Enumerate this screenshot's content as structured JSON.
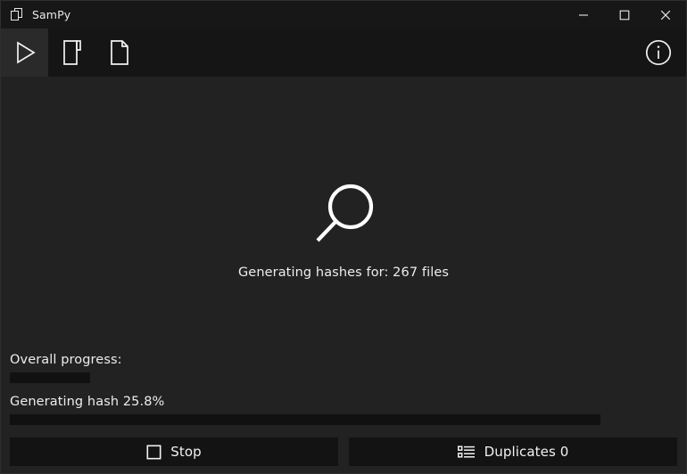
{
  "window": {
    "title": "SamPy",
    "app_icon": "two-squares-icon",
    "controls": [
      {
        "name": "minimize",
        "icon": "minimize-icon"
      },
      {
        "name": "maximize",
        "icon": "maximize-icon"
      },
      {
        "name": "close",
        "icon": "close-icon"
      }
    ]
  },
  "toolbar": {
    "buttons": [
      {
        "name": "start",
        "icon": "play-icon",
        "active": true
      },
      {
        "name": "select-folder",
        "icon": "folder-icon",
        "active": false
      },
      {
        "name": "select-file",
        "icon": "file-icon",
        "active": false
      }
    ],
    "info": {
      "name": "info",
      "icon": "info-circle-icon"
    }
  },
  "main": {
    "status_icon": "magnifier-icon",
    "status_text": "Generating hashes for: 267 files"
  },
  "progress": {
    "overall_label": "Overall progress:",
    "overall_percent": 13.6,
    "hash_label": "Generating hash 25.8%",
    "hash_percent": 100
  },
  "footer": {
    "stop_label": "Stop",
    "stop_icon": "stop-square-icon",
    "duplicates_label": "Duplicates 0",
    "duplicates_icon": "list-icon"
  },
  "colors": {
    "window_bg": "#222222",
    "titlebar_bg": "#171717",
    "toolbar_bg": "#151515",
    "toolbar_active": "#2a2a2a",
    "bar_fill": "#111111",
    "button_bg": "#131313",
    "text": "#ededed"
  }
}
